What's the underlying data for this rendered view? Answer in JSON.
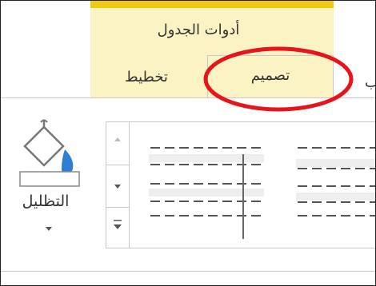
{
  "ribbon": {
    "context_group_title": "أدوات الجدول",
    "tabs": [
      {
        "label": "تخطيط"
      },
      {
        "label": "تصميم",
        "selected": true
      },
      {
        "label": "ب"
      }
    ],
    "context_color": "#f2c811"
  },
  "shading": {
    "label": "التظليل"
  },
  "annotation": {
    "color": "#e8141b",
    "target": "تصميم"
  }
}
